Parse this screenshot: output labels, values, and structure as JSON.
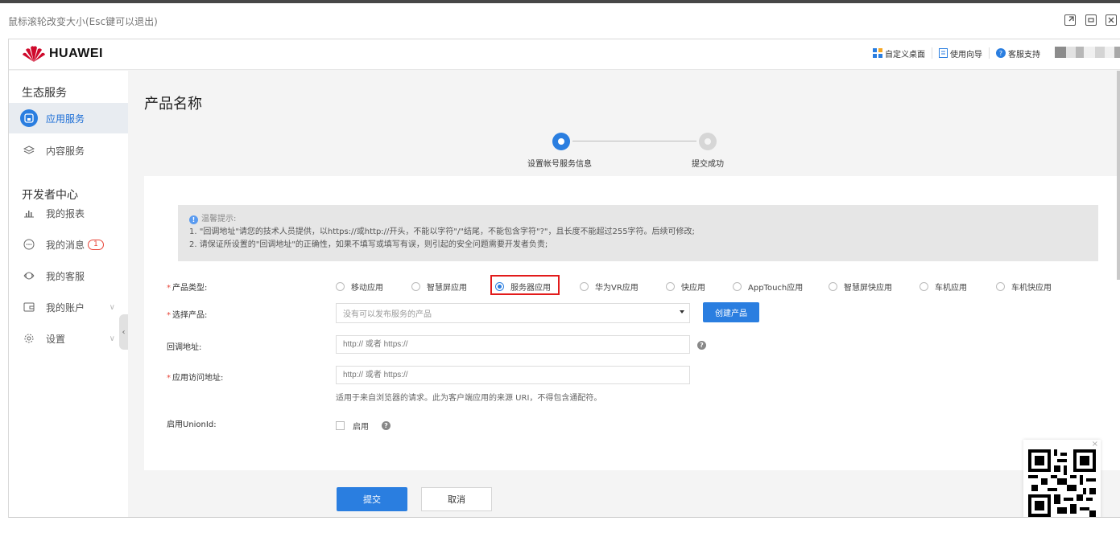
{
  "viewer": {
    "hint": "鼠标滚轮改变大小(Esc键可以退出)"
  },
  "header": {
    "logo_text": "HUAWEI",
    "links": [
      {
        "label": "自定义桌面",
        "icon": "grid-icon"
      },
      {
        "label": "使用向导",
        "icon": "document-icon"
      },
      {
        "label": "客服支持",
        "icon": "help-circle-icon"
      }
    ]
  },
  "sidebar": {
    "group1": "生态服务",
    "group2": "开发者中心",
    "items": [
      {
        "label": "应用服务",
        "icon": "app-service-icon",
        "active": true
      },
      {
        "label": "内容服务",
        "icon": "layers-icon"
      },
      {
        "label": "我的报表",
        "icon": "bar-chart-icon"
      },
      {
        "label": "我的消息",
        "icon": "message-icon",
        "badge": "1"
      },
      {
        "label": "我的客服",
        "icon": "headset-icon"
      },
      {
        "label": "我的账户",
        "icon": "wallet-icon"
      },
      {
        "label": "设置",
        "icon": "gear-icon"
      }
    ]
  },
  "page": {
    "title": "产品名称",
    "steps": [
      "设置帐号服务信息",
      "提交成功"
    ]
  },
  "tip": {
    "title": "温馨提示:",
    "line1": "1. \"回调地址\"请您的技术人员提供，以https://或http://开头，不能以字符\"/\"结尾，不能包含字符\"?\"，且长度不能超过255字符。后续可修改;",
    "line2": "2. 请保证所设置的\"回调地址\"的正确性，如果不填写或填写有误，则引起的安全问题需要开发者负责;"
  },
  "form": {
    "product_type_label": "产品类型:",
    "product_types": [
      "移动应用",
      "智慧屏应用",
      "服务器应用",
      "华为VR应用",
      "快应用",
      "AppTouch应用",
      "智慧屏快应用",
      "车机应用",
      "车机快应用"
    ],
    "selected_type": "服务器应用",
    "select_product_label": "选择产品:",
    "select_product_placeholder": "没有可以发布服务的产品",
    "create_product_button": "创建产品",
    "callback_label": "回调地址:",
    "callback_placeholder": "http:// 或者 https://",
    "access_url_label": "应用访问地址:",
    "access_url_placeholder": "http:// 或者 https://",
    "access_url_hint": "适用于来自浏览器的请求。此为客户端应用的来源 URI，不得包含通配符。",
    "unionid_label": "启用UnionId:",
    "unionid_checkbox_label": "启用"
  },
  "actions": {
    "submit": "提交",
    "cancel": "取消"
  },
  "colors": {
    "primary": "#2a7ee0",
    "highlight": "#e21b1b",
    "required": "#e8463a"
  }
}
